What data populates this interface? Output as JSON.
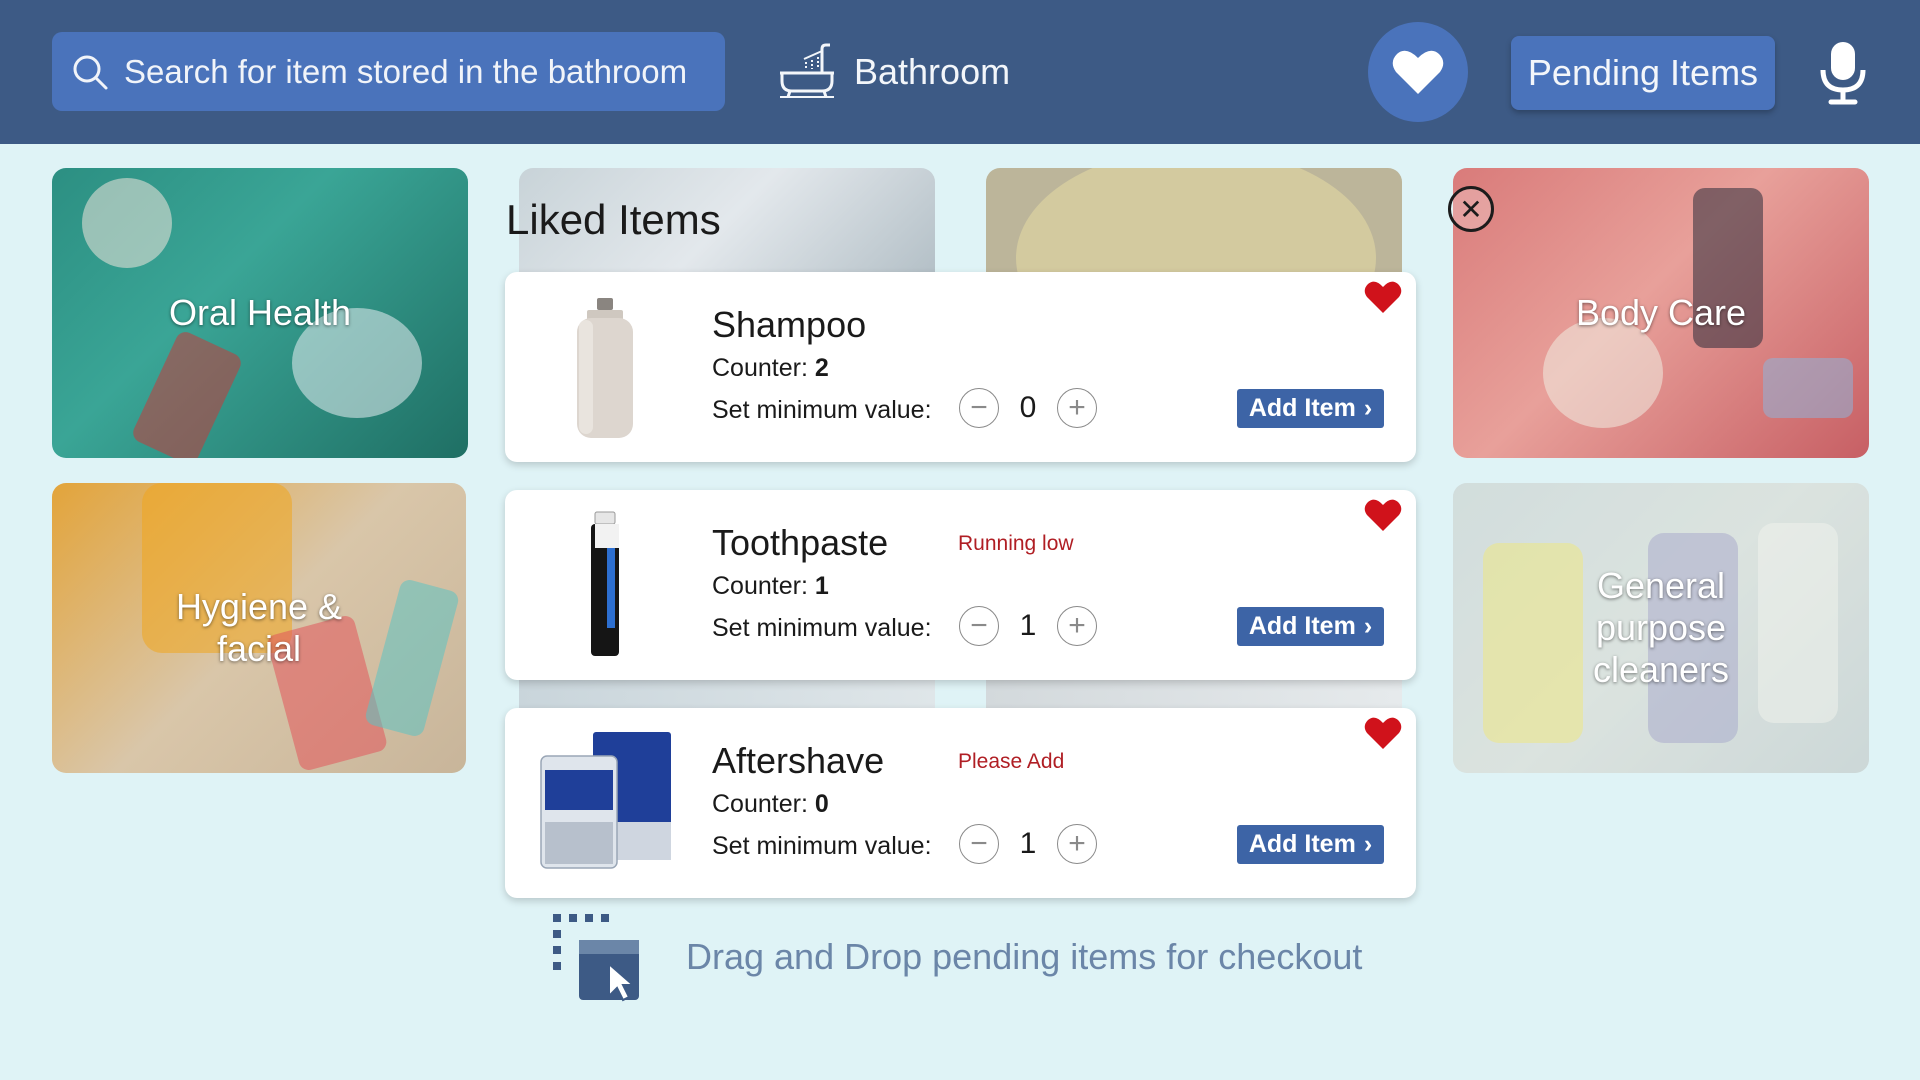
{
  "header": {
    "search_placeholder": "Search for item stored in the bathroom",
    "room_name": "Bathroom",
    "pending_label": "Pending Items",
    "icons": [
      "search-icon",
      "bathtub-icon",
      "heart-icon",
      "microphone-icon"
    ]
  },
  "categories": [
    {
      "label": "Oral Health"
    },
    {
      "label": "Body Care"
    },
    {
      "label": "Hygiene & facial"
    },
    {
      "label": "General purpose cleaners"
    }
  ],
  "liked": {
    "title": "Liked Items",
    "min_label": "Set minimum value:",
    "counter_label": "Counter:",
    "add_label": "Add Item",
    "items": [
      {
        "name": "Shampoo",
        "status": "",
        "counter": "2",
        "min_value": "0"
      },
      {
        "name": "Toothpaste",
        "status": "Running low",
        "counter": "1",
        "min_value": "1"
      },
      {
        "name": "Aftershave",
        "status": "Please Add",
        "counter": "0",
        "min_value": "1"
      }
    ]
  },
  "dnd": {
    "text": "Drag and Drop pending items for checkout"
  },
  "colors": {
    "header": "#3d5a85",
    "accent": "#4a73bb",
    "background": "#dff3f6",
    "heart": "#d0121b",
    "status": "#b01e24",
    "button": "#3d64a6"
  }
}
